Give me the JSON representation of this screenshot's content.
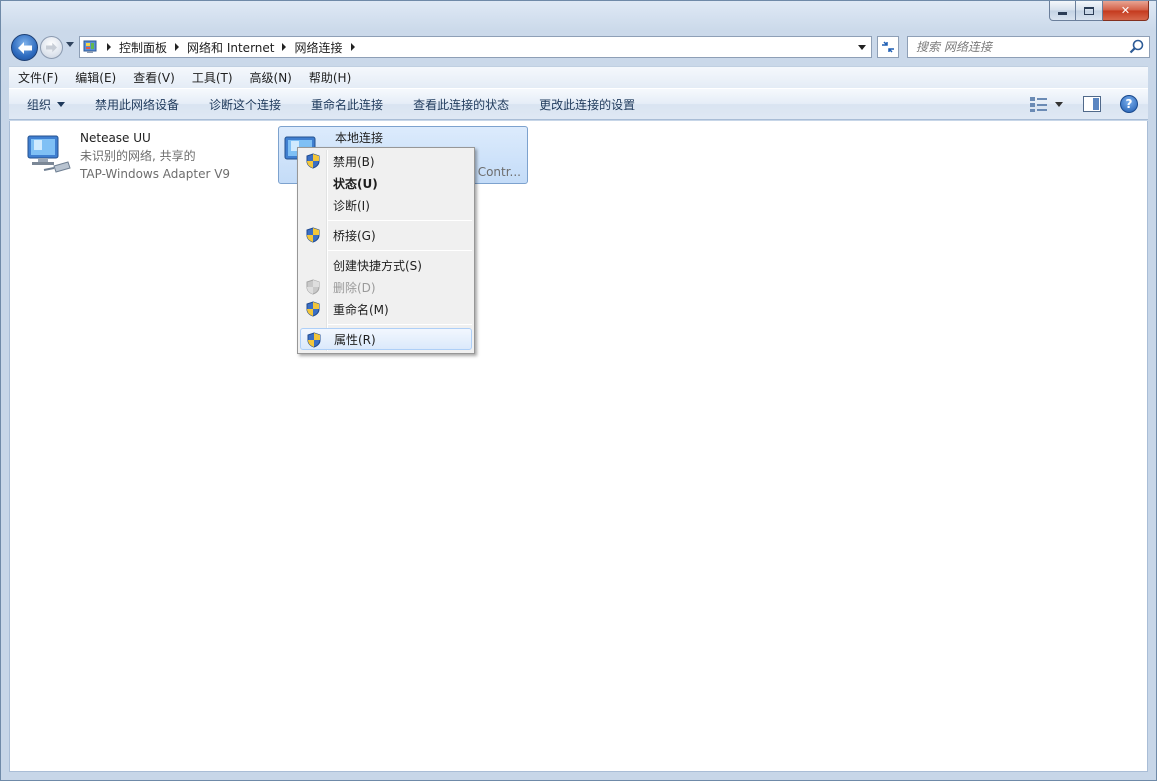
{
  "window": {
    "caption": {
      "minimize": "",
      "maximize": "",
      "close": "✕"
    }
  },
  "address": {
    "crumbs": [
      "控制面板",
      "网络和 Internet",
      "网络连接"
    ]
  },
  "search": {
    "placeholder": "搜索 网络连接"
  },
  "menubar": [
    "文件(F)",
    "编辑(E)",
    "查看(V)",
    "工具(T)",
    "高级(N)",
    "帮助(H)"
  ],
  "commands": {
    "organize": "组织",
    "items": [
      "禁用此网络设备",
      "诊断这个连接",
      "重命名此连接",
      "查看此连接的状态",
      "更改此连接的设置"
    ]
  },
  "connections": [
    {
      "name": "Netease UU",
      "status": "未识别的网络, 共享的",
      "device": "TAP-Windows Adapter V9"
    },
    {
      "name": "本地连接",
      "device_partial": "Contr..."
    }
  ],
  "context_menu": [
    {
      "label": "禁用(B)",
      "shield": true
    },
    {
      "label": "状态(U)",
      "bold": true
    },
    {
      "label": "诊断(I)"
    },
    {
      "label": "桥接(G)",
      "shield": true
    },
    {
      "label": "创建快捷方式(S)"
    },
    {
      "label": "删除(D)",
      "shield": true,
      "disabled": true
    },
    {
      "label": "重命名(M)",
      "shield": true
    },
    {
      "label": "属性(R)",
      "shield": true,
      "selected": true
    }
  ],
  "colors": {
    "accent": "#2f6cc0",
    "selection": "#c4dcf8",
    "window": "#cbd9ea"
  }
}
